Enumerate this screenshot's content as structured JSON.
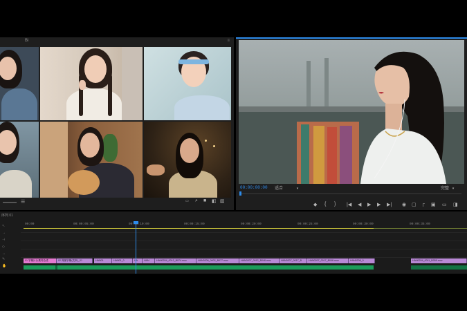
{
  "project": {
    "tab_label": "Bi",
    "footer_zoom": "",
    "thumbnails": [
      {
        "name": "thumb-1",
        "skin": "#e8c2ab",
        "bg": "#3d4a58",
        "shirt": "#5a7794"
      },
      {
        "name": "thumb-2",
        "skin": "#f0cdb6",
        "bg": "#ddd2c4",
        "shirt": "#f1ece4"
      },
      {
        "name": "thumb-3",
        "skin": "#f3d1bb",
        "bg": "#bcd1d6",
        "shirt": "#c3d6e5"
      },
      {
        "name": "thumb-4",
        "skin": "#e9c4ad",
        "bg": "#6b7d86",
        "shirt": "#d9d4c8"
      },
      {
        "name": "thumb-5",
        "skin": "#e3b79c",
        "bg": "#7a5236",
        "shirt": "#2b2a33"
      },
      {
        "name": "thumb-6",
        "skin": "#d9a98b",
        "bg": "#2e2216",
        "shirt": "#c9b48c"
      }
    ]
  },
  "program": {
    "timecode": "00:00:00:00",
    "fit_label": "适合",
    "full_label": "完整"
  },
  "timeline": {
    "sequence_label": "序列 01",
    "ruler": [
      "00:00",
      "00:00:05:00",
      "00:00:10:00",
      "00:00:15:00",
      "00:00:20:00",
      "00:00:25:00",
      "00:00:30:00",
      "00:00:35:00"
    ],
    "clips": [
      {
        "label": "01 字幕片头素材合成",
        "color": "pink"
      },
      {
        "label": "02 背景字幕(文本)_01",
        "color": "purple"
      },
      {
        "label": "HAN01",
        "color": "purple"
      },
      {
        "label": "HAN01_0",
        "color": "purple"
      },
      {
        "label": "HA",
        "color": "purple"
      },
      {
        "label": "HAN",
        "color": "purple"
      },
      {
        "label": "HAN0204_0012_B074.mov",
        "color": "purple"
      },
      {
        "label": "HAN0206_0002_B077.mov",
        "color": "purple"
      },
      {
        "label": "HAN0207_0012_B046.mov",
        "color": "purple"
      },
      {
        "label": "HAN0207_0017_B",
        "color": "purple"
      },
      {
        "label": "HAN0207_0017_B046.mov",
        "color": "purple"
      },
      {
        "label": "HAN0208_0",
        "color": "purple"
      },
      {
        "label": "HAN0204_0011_B059.mov",
        "color": "purple"
      }
    ]
  },
  "colors": {
    "accent": "#2d8ceb",
    "clip_purple": "#b989d6",
    "clip_pink": "#e57ad1",
    "audio_green": "#1c9c5a"
  }
}
